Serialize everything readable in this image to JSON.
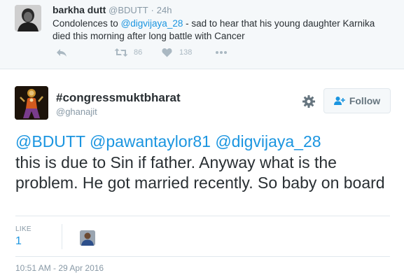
{
  "parent_tweet": {
    "name": "barkha dutt",
    "handle": "@BDUTT",
    "separator": "·",
    "time": "24h",
    "text_before": "Condolences to ",
    "mention": "@digvijaya_28",
    "text_after": " - sad to hear that his young daughter Karnika died this morning after long battle with Cancer",
    "retweet_count": "86",
    "like_count": "138",
    "icons": [
      "reply-icon",
      "retweet-icon",
      "heart-icon",
      "more-icon"
    ]
  },
  "main_tweet": {
    "name": "#congressmuktbharat",
    "handle": "@ghanajit",
    "follow_label": "Follow",
    "mentions": "@BDUTT @pawantaylor81 @digvijaya_28",
    "text": "this is due to Sin if father. Anyway what is the problem. He got married recently. So baby on board",
    "likes_label": "LIKE",
    "likes_count": "1",
    "timestamp": "10:51 AM - 29 Apr 2016",
    "icons": [
      "gear-icon",
      "follow-user-icon"
    ]
  },
  "colors": {
    "link": "#1b95e0",
    "muted": "#8899a6",
    "icon_gray": "#aab8c2",
    "parent_bg": "#f5f8fa",
    "border": "#e1e8ed"
  }
}
